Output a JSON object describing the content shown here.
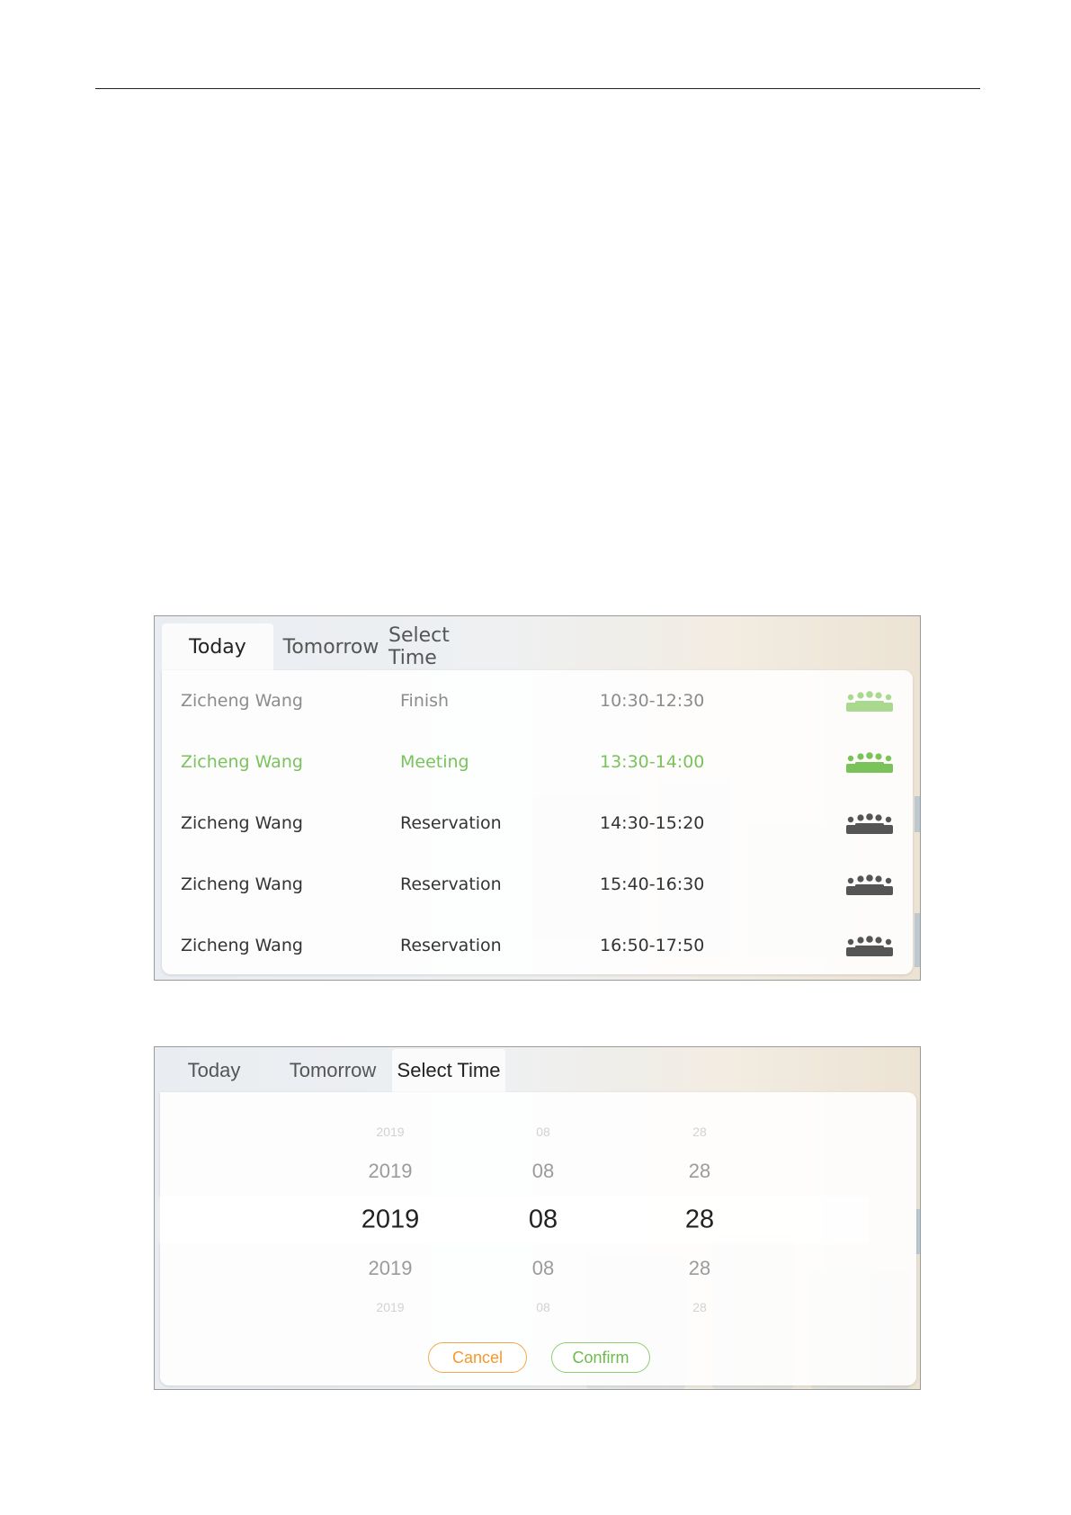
{
  "colors": {
    "active_green": "#79c35a",
    "finished_gray": "#8c8c8c",
    "cancel_orange": "#f39a2c",
    "confirm_green": "#6dbb4c"
  },
  "list_view": {
    "tabs": [
      {
        "label": "Today",
        "active": true
      },
      {
        "label": "Tomorrow",
        "active": false
      },
      {
        "label": "Select Time",
        "active": false
      }
    ],
    "rows": [
      {
        "name": "Zicheng Wang",
        "status": "Finish",
        "time": "10:30-12:30",
        "state": "done",
        "icon": "meeting-people-icon"
      },
      {
        "name": "Zicheng Wang",
        "status": "Meeting",
        "time": "13:30-14:00",
        "state": "active",
        "icon": "meeting-people-icon"
      },
      {
        "name": "Zicheng Wang",
        "status": "Reservation",
        "time": "14:30-15:20",
        "state": "reserved",
        "icon": "meeting-people-icon"
      },
      {
        "name": "Zicheng Wang",
        "status": "Reservation",
        "time": "15:40-16:30",
        "state": "reserved",
        "icon": "meeting-people-icon"
      },
      {
        "name": "Zicheng Wang",
        "status": "Reservation",
        "time": "16:50-17:50",
        "state": "reserved",
        "icon": "meeting-people-icon"
      }
    ]
  },
  "picker_view": {
    "tabs": [
      {
        "label": "Today",
        "active": false
      },
      {
        "label": "Tomorrow",
        "active": false
      },
      {
        "label": "Select Time",
        "active": true
      }
    ],
    "year_options": [
      "2019",
      "2019",
      "2019",
      "2019",
      "2019"
    ],
    "month_options": [
      "08",
      "08",
      "08",
      "08",
      "08"
    ],
    "day_options": [
      "28",
      "28",
      "28",
      "28",
      "28"
    ],
    "selected": {
      "year": "2019",
      "month": "08",
      "day": "28"
    },
    "cancel_label": "Cancel",
    "confirm_label": "Confirm"
  }
}
